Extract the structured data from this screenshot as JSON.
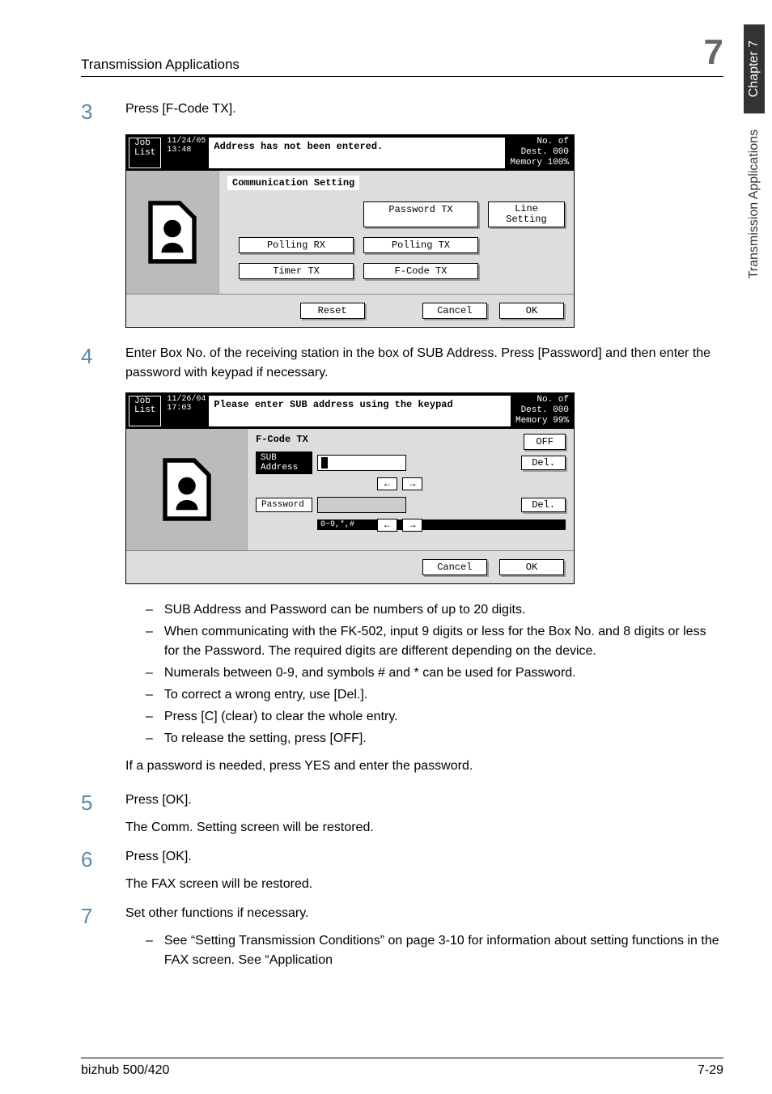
{
  "header": {
    "title": "Transmission Applications",
    "chapter_num": "7"
  },
  "sidetab": {
    "chapter": "Chapter 7",
    "section": "Transmission Applications"
  },
  "step3": {
    "num": "3",
    "text": "Press [F-Code TX]."
  },
  "ss1": {
    "joblist_l1": "Job",
    "joblist_l2": "List",
    "date": "11/24/05",
    "time": "13:48",
    "msg": "Address has not been entered.",
    "dest_label": "No. of\nDest.",
    "dest_val": "000",
    "mem_label": "Memory",
    "mem_val": "100%",
    "heading": "Communication Setting",
    "btn_pwdtx": "Password TX",
    "btn_line_l1": "Line",
    "btn_line_l2": "Setting",
    "btn_pollrx": "Polling RX",
    "btn_polltx": "Polling TX",
    "btn_timertx": "Timer TX",
    "btn_fcodetx": "F-Code TX",
    "btn_reset": "Reset",
    "btn_cancel": "Cancel",
    "btn_ok": "OK"
  },
  "step4": {
    "num": "4",
    "text": "Enter Box No. of the receiving station in the box of SUB Address. Press [Password] and then enter the password with keypad if necessary."
  },
  "ss2": {
    "joblist_l1": "Job",
    "joblist_l2": "List",
    "date": "11/26/04",
    "time": "17:03",
    "msg": "Please enter SUB address using the keypad",
    "dest_label": "No. of\nDest.",
    "dest_val": "000",
    "mem_label": "Memory",
    "mem_val": "99%",
    "title": "F-Code TX",
    "off": "OFF",
    "sub_l1": "SUB",
    "sub_l2": "Address",
    "pwd": "Password",
    "del": "Del.",
    "hint": "0~9,*,#",
    "arrow_l": "←",
    "arrow_r": "→",
    "btn_cancel": "Cancel",
    "btn_ok": "OK"
  },
  "bullets": {
    "b1": "SUB Address and Password can be numbers of up to 20 digits.",
    "b2": "When communicating with the FK-502, input 9 digits or less for the Box No. and 8 digits or less for the Password. The required digits are different depending on the device.",
    "b3": "Numerals between 0-9, and symbols # and * can be used for Password.",
    "b4": "To correct a wrong entry, use [Del.].",
    "b5": "Press [C] (clear) to clear the whole entry.",
    "b6": "To release the setting, press [OFF]."
  },
  "note1": "If a password is needed, press YES and enter the password.",
  "step5": {
    "num": "5",
    "text": "Press [OK].",
    "sub": "The Comm. Setting screen will be restored."
  },
  "step6": {
    "num": "6",
    "text": "Press [OK].",
    "sub": "The FAX screen will be restored."
  },
  "step7": {
    "num": "7",
    "text": "Set other functions if necessary.",
    "bullet": "See “Setting Transmission Conditions” on page 3-10 for information about setting functions in the FAX screen. See “Application"
  },
  "footer": {
    "left": "bizhub 500/420",
    "right": "7-29"
  }
}
